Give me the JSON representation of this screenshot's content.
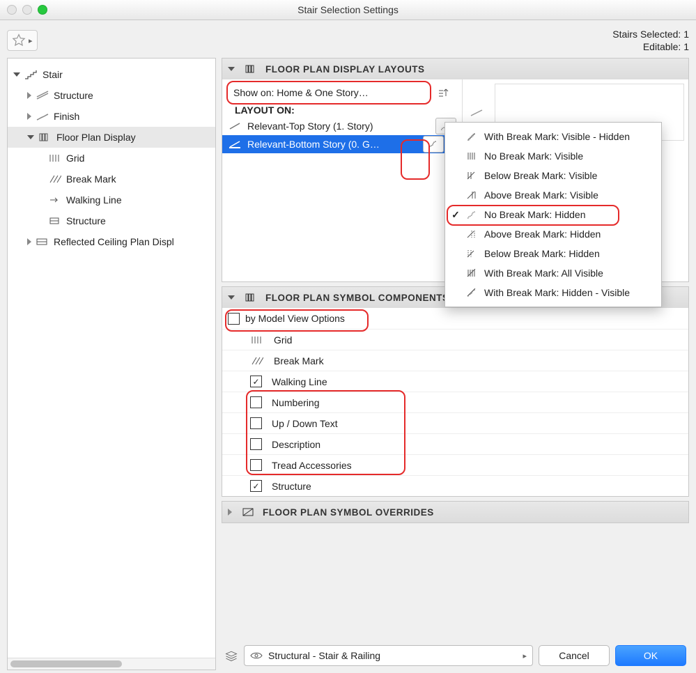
{
  "window": {
    "title": "Stair Selection Settings"
  },
  "status": {
    "line1": "Stairs Selected: 1",
    "line2": "Editable: 1"
  },
  "sidebar": {
    "items": [
      {
        "label": "Stair"
      },
      {
        "label": "Structure"
      },
      {
        "label": "Finish"
      },
      {
        "label": "Floor Plan Display"
      },
      {
        "label": "Grid"
      },
      {
        "label": "Break Mark"
      },
      {
        "label": "Walking Line"
      },
      {
        "label": "Structure"
      },
      {
        "label": "Reflected Ceiling Plan Displ"
      }
    ]
  },
  "sections": {
    "layouts": {
      "title": "FLOOR PLAN DISPLAY LAYOUTS",
      "show_on": "Show on: Home & One Story…",
      "layout_on": "LAYOUT ON:",
      "rows": [
        {
          "label": "Relevant-Top Story (1. Story)"
        },
        {
          "label": "Relevant-Bottom Story (0. G…"
        }
      ]
    },
    "components": {
      "title": "FLOOR PLAN SYMBOL COMPONENTS",
      "mvo": "by Model View Options",
      "items": [
        {
          "label": "Grid",
          "checked": false,
          "noncheck": true
        },
        {
          "label": "Break Mark",
          "checked": false,
          "noncheck": true
        },
        {
          "label": "Walking Line",
          "checked": true
        },
        {
          "label": "Numbering",
          "checked": false
        },
        {
          "label": "Up / Down Text",
          "checked": false
        },
        {
          "label": "Description",
          "checked": false
        },
        {
          "label": "Tread Accessories",
          "checked": false
        },
        {
          "label": "Structure",
          "checked": true
        }
      ]
    },
    "overrides": {
      "title": "FLOOR PLAN SYMBOL OVERRIDES"
    }
  },
  "dropdown": {
    "items": [
      {
        "label": "With Break Mark: Visible - Hidden",
        "checked": false
      },
      {
        "label": "No Break Mark: Visible",
        "checked": false
      },
      {
        "label": "Below Break Mark: Visible",
        "checked": false
      },
      {
        "label": "Above Break Mark: Visible",
        "checked": false
      },
      {
        "label": "No Break Mark: Hidden",
        "checked": true
      },
      {
        "label": "Above Break Mark: Hidden",
        "checked": false
      },
      {
        "label": "Below Break Mark: Hidden",
        "checked": false
      },
      {
        "label": "With Break Mark: All Visible",
        "checked": false
      },
      {
        "label": "With Break Mark: Hidden - Visible",
        "checked": false
      }
    ]
  },
  "footer": {
    "layer": "Structural - Stair & Railing",
    "cancel": "Cancel",
    "ok": "OK"
  }
}
